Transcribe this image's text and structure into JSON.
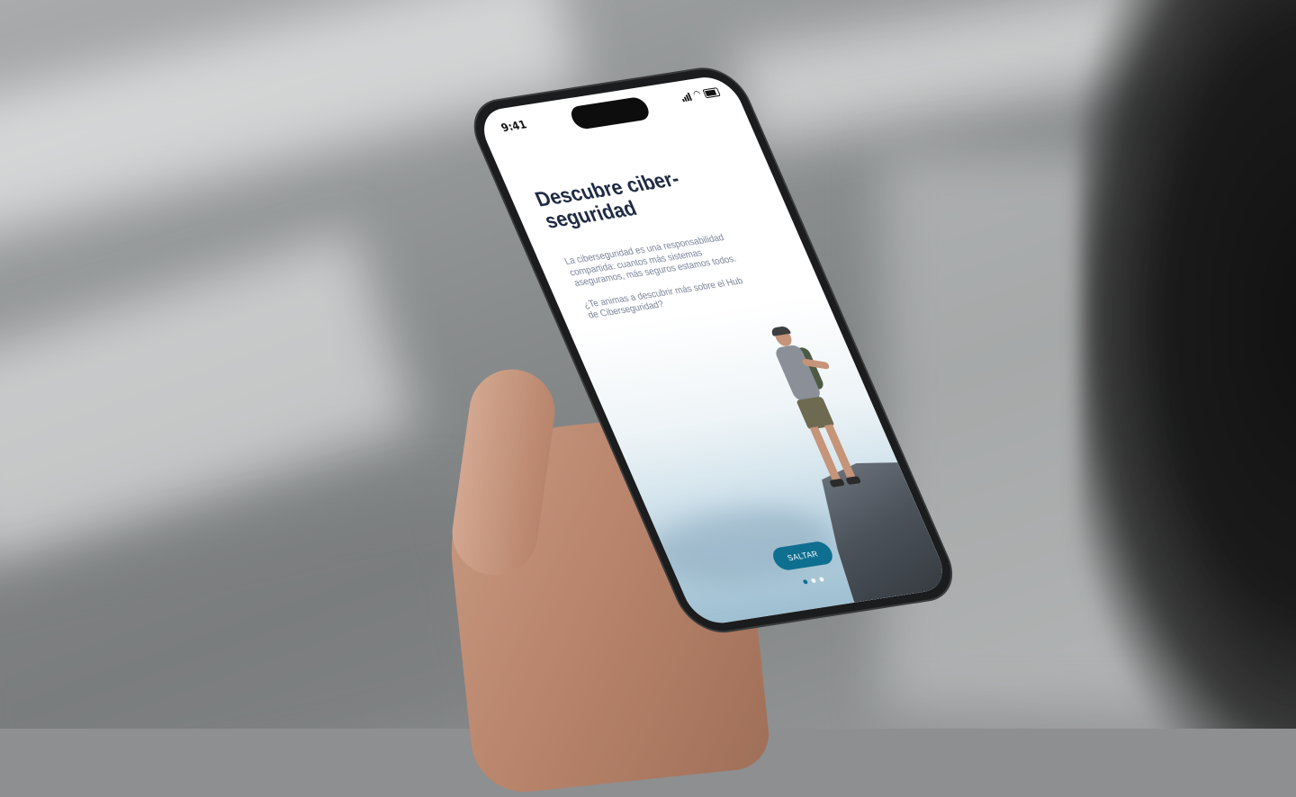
{
  "status_bar": {
    "time": "9:41"
  },
  "onboarding": {
    "title": "Descubre ciber-seguridad",
    "paragraphs": [
      "La ciberseguridad es una responsabilidad compartida: cuantos más sistemas aseguramos, más seguros estamos todos.",
      "¿Te animas a descubrir más sobre el Hub de Ciberseguridad?"
    ],
    "skip_label": "SALTAR",
    "pager": {
      "total": 3,
      "active": 1
    }
  },
  "colors": {
    "accent": "#0e6f90",
    "title": "#1f2a44",
    "body": "#7b8499"
  },
  "icons": [
    "signal-icon",
    "wifi-icon",
    "battery-icon"
  ]
}
